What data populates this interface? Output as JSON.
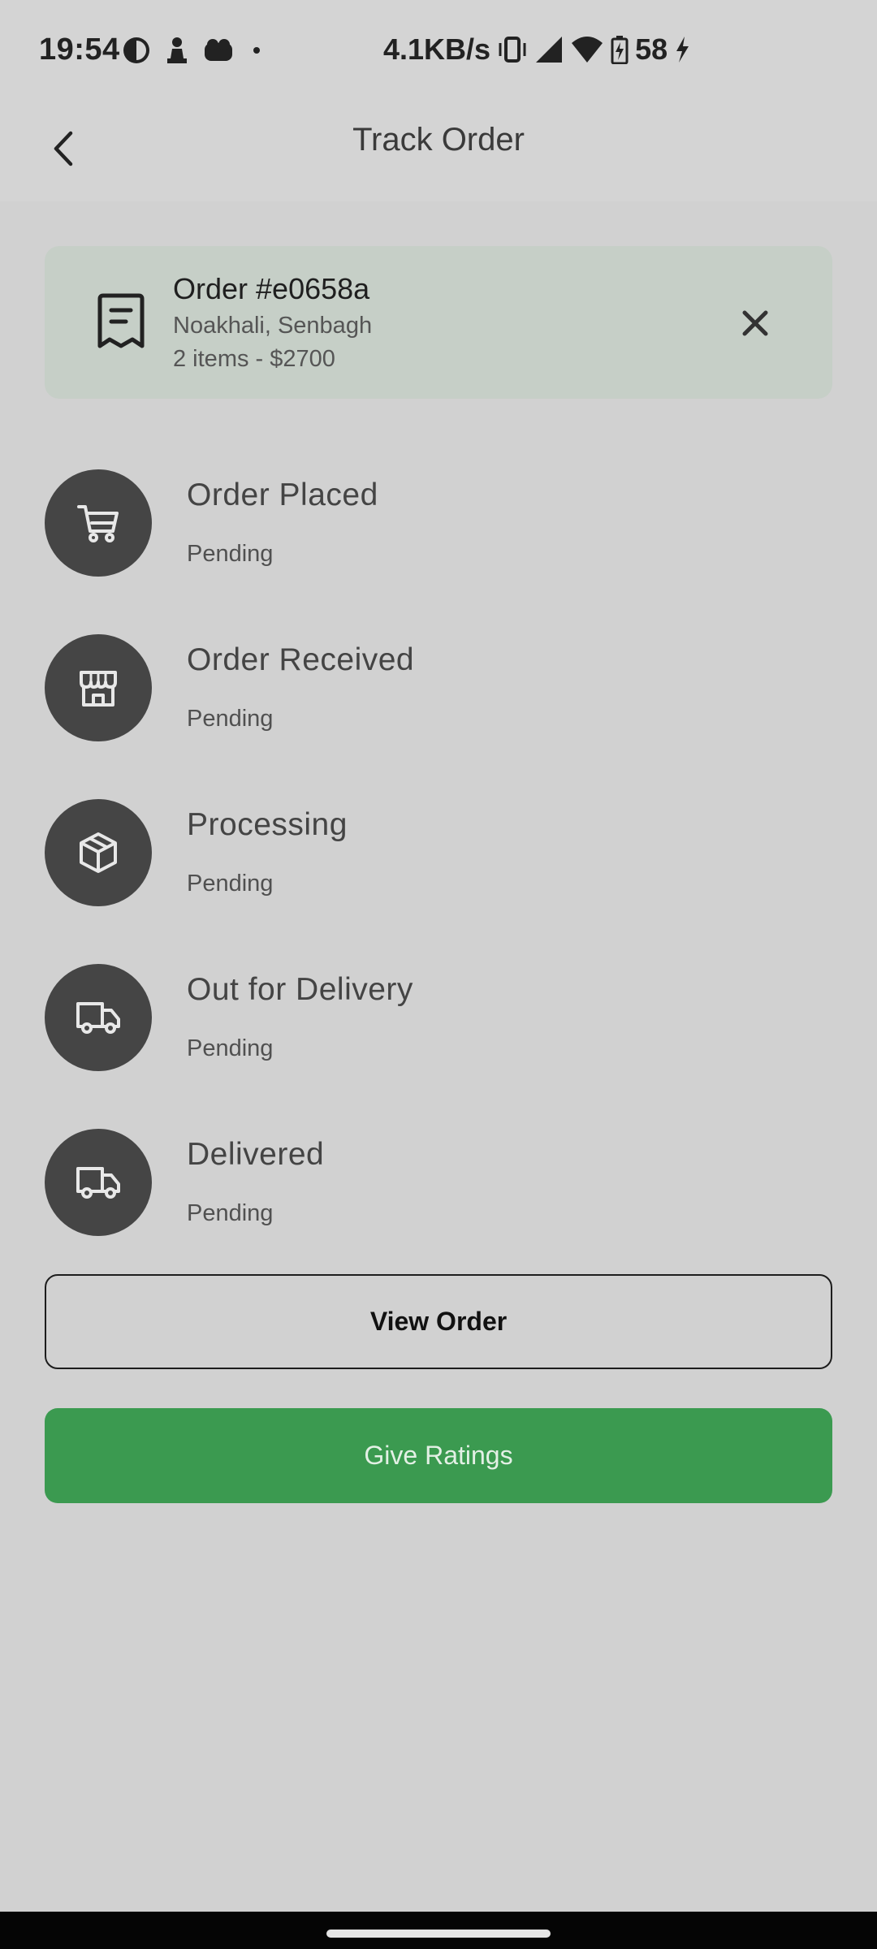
{
  "status_bar": {
    "time": "19:54",
    "network_speed": "4.1KB/s",
    "battery_level": "58"
  },
  "app_bar": {
    "title": "Track Order"
  },
  "order": {
    "title": "Order #e0658a",
    "location": "Noakhali, Senbagh",
    "summary": "2 items - $2700"
  },
  "steps": [
    {
      "title": "Order Placed",
      "status": "Pending",
      "icon": "cart-icon"
    },
    {
      "title": "Order Received",
      "status": "Pending",
      "icon": "store-icon"
    },
    {
      "title": "Processing",
      "status": "Pending",
      "icon": "package-icon"
    },
    {
      "title": "Out for Delivery",
      "status": "Pending",
      "icon": "truck-icon"
    },
    {
      "title": "Delivered",
      "status": "Pending",
      "icon": "truck-icon"
    }
  ],
  "actions": {
    "view_order_label": "View Order",
    "give_ratings_label": "Give Ratings"
  },
  "colors": {
    "background": "#d1d1d1",
    "card": "#c6cfc7",
    "step_circle": "#454545",
    "accent_green": "#3b9a50"
  }
}
